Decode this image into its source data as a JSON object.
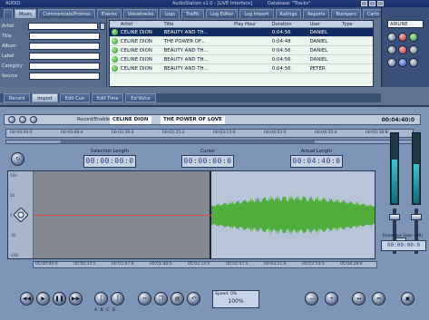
{
  "window": {
    "title_left": "AUDIO",
    "title_center": "AudioStation v1.0 - [LIVE Interface]",
    "title_right": "Database: \"Tracks\""
  },
  "toolbar_tabs": [
    "",
    "Music",
    "Commercials/Promos",
    "Events",
    "Voicetracks",
    "Logs",
    "Traffic",
    "Log Editor",
    "Log Import",
    "Ratings",
    "Reports",
    "Bumpers",
    "Carts"
  ],
  "filter": {
    "fields": [
      {
        "label": "Artist",
        "value": ""
      },
      {
        "label": "Title",
        "value": ""
      },
      {
        "label": "Album",
        "value": ""
      },
      {
        "label": "Label",
        "value": ""
      },
      {
        "label": "Category",
        "value": ""
      },
      {
        "label": "Source",
        "value": ""
      }
    ]
  },
  "results": {
    "headers": [
      "",
      "Artist",
      "Title",
      "Play Hour",
      "Duration",
      "User",
      "Type"
    ],
    "rows": [
      {
        "artist": "CELINE DION",
        "title": "BEAUTY AND TH...",
        "hour": "",
        "duration": "0:04:56",
        "user": "DANIEL",
        "type": "",
        "selected": true
      },
      {
        "artist": "CELINE DION",
        "title": "THE POWER OF...",
        "hour": "",
        "duration": "0:04:48",
        "user": "DANIEL",
        "type": "",
        "selected": false
      },
      {
        "artist": "CELINE DION",
        "title": "BEAUTY AND TH...",
        "hour": "",
        "duration": "0:04:56",
        "user": "DANIEL",
        "type": "",
        "selected": false
      },
      {
        "artist": "CELINE DION",
        "title": "BEAUTY AND TH...",
        "hour": "",
        "duration": "0:04:56",
        "user": "DANIEL",
        "type": "",
        "selected": false
      },
      {
        "artist": "CELINE DION",
        "title": "BEAUTY AND TH...",
        "hour": "",
        "duration": "0:04:56",
        "user": "PETER",
        "type": "",
        "selected": false
      }
    ]
  },
  "right_panel": {
    "label": "AIRLINE"
  },
  "tabs2": [
    "Record",
    "Import",
    "Edit Cue",
    "Edit Time",
    "Ed Voice"
  ],
  "editor": {
    "record_label": "Record/Enable",
    "record_artist": "CELINE DION",
    "record_title": "THE POWER OF LOVE",
    "record_time": "00:04:40:0",
    "timeline_ticks": [
      "00:00:00:0",
      "00:00:48:4",
      "00:01:36:8",
      "00:02:25:2",
      "00:03:13:6",
      "00:04:02:0",
      "00:04:50:4",
      "00:05:38:8"
    ],
    "lcd_labels": [
      "Selection Length",
      "Cursor",
      "Actual Length"
    ],
    "lcd_values": [
      "00:00:00:0",
      "00:00:00:0",
      "00:04:40:0"
    ],
    "scale_labels": [
      "100",
      "50",
      "0",
      "-50",
      "-100"
    ],
    "bottom_ticks": [
      "00:00:00:0",
      "00:00:33:5",
      "00:01:07:0",
      "00:01:40:5",
      "00:02:14:0",
      "00:02:47:5",
      "00:03:21:0",
      "00:03:54:5",
      "00:04:28:0"
    ],
    "gain_label": "Envelope Gain (dB)",
    "gain_value": "00:00:00:0",
    "speed_label": "Speed: 0%",
    "speed_value": "100%",
    "marks": "A B C D"
  },
  "levels": {
    "left": 0.62,
    "right": 0.55
  },
  "colors": {
    "window_bg": "#5f7490",
    "editor_bg": "#7d95b7",
    "selected_row": "#0f2a5e",
    "waveform": "#4fae3c",
    "cue_line": "#d44a3b"
  }
}
